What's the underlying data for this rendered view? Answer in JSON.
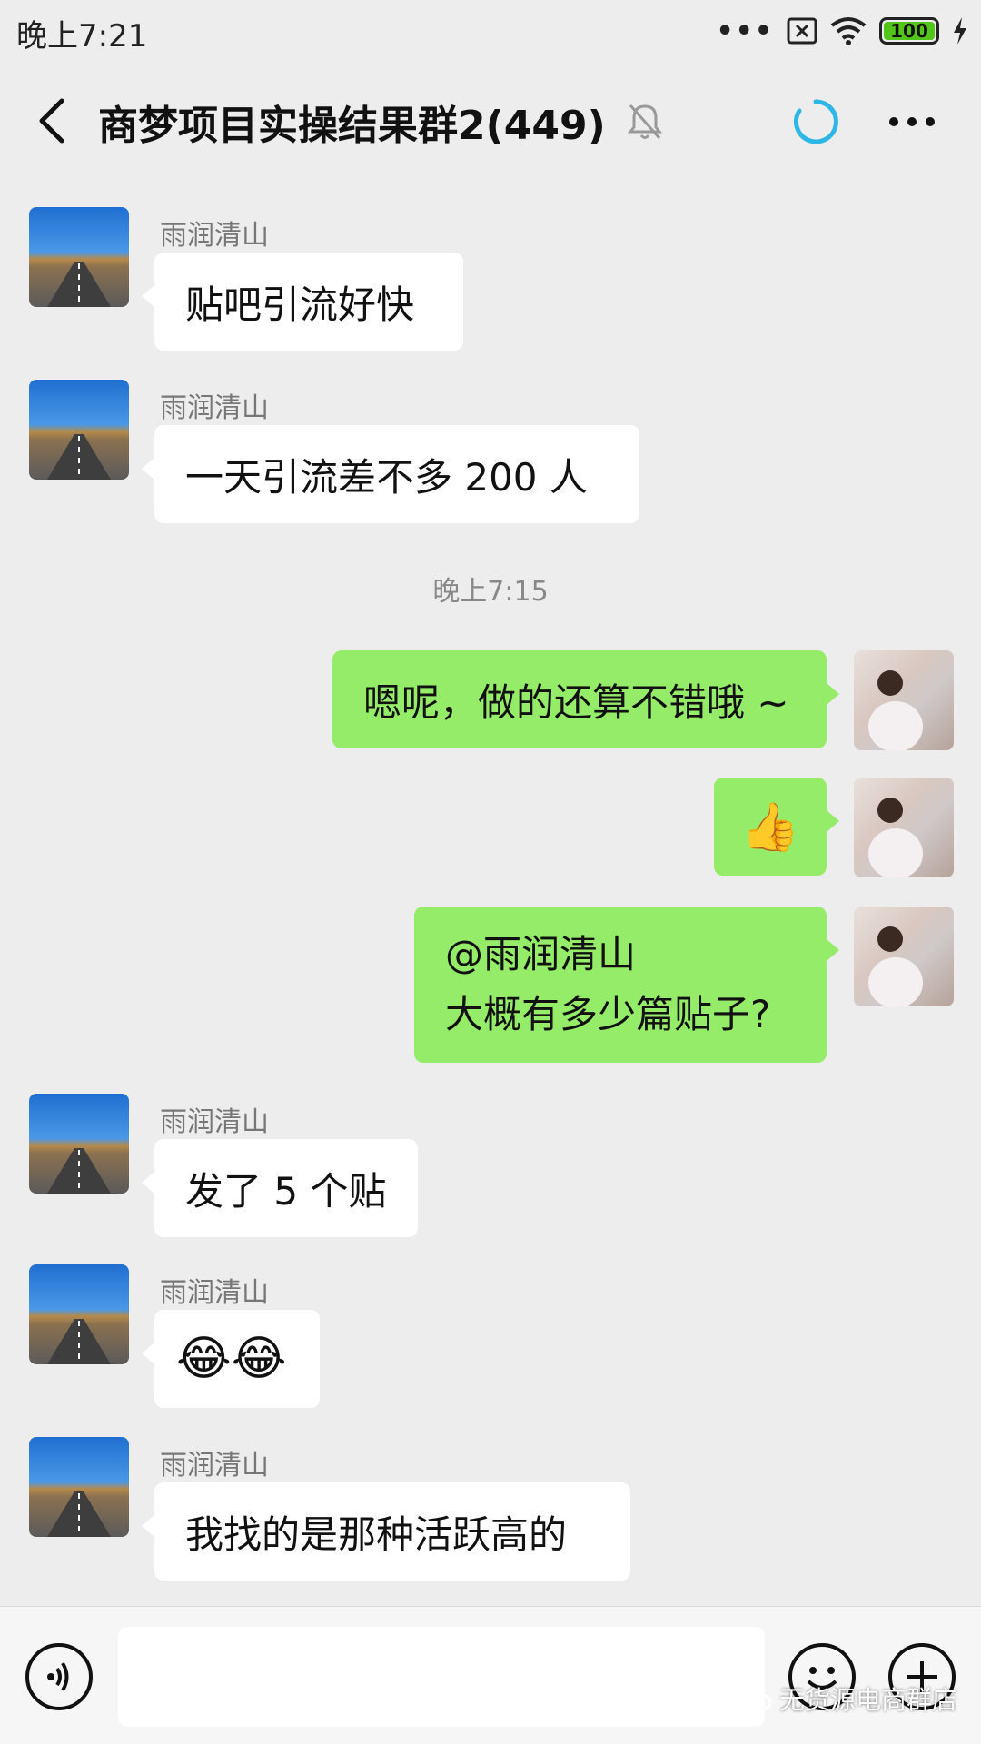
{
  "status_bar": {
    "time": "晚上7:21",
    "battery": "100"
  },
  "header": {
    "title": "商梦项目实操结果群2(449)"
  },
  "timestamp": "晚上7:15",
  "messages": [
    {
      "side": "left",
      "sender": "雨润清山",
      "text": "贴吧引流好快"
    },
    {
      "side": "left",
      "sender": "雨润清山",
      "text": "一天引流差不多 200 人"
    },
    {
      "side": "right",
      "text": "嗯呢，做的还算不错哦 ~"
    },
    {
      "side": "right",
      "emoji": "👍"
    },
    {
      "side": "right",
      "lines": [
        "@雨润清山",
        "大概有多少篇贴子?"
      ]
    },
    {
      "side": "left",
      "sender": "雨润清山",
      "text": "发了 5 个贴"
    },
    {
      "side": "left",
      "sender": "雨润清山",
      "emoji": "😂😂"
    },
    {
      "side": "left",
      "sender": "雨润清山",
      "text": "我找的是那种活跃高的"
    }
  ],
  "input": {
    "value": ""
  },
  "watermark": "无货源电商群店",
  "colors": {
    "background": "#ededed",
    "self_bubble": "#95ec69",
    "other_bubble": "#ffffff",
    "battery": "#52c41a"
  }
}
